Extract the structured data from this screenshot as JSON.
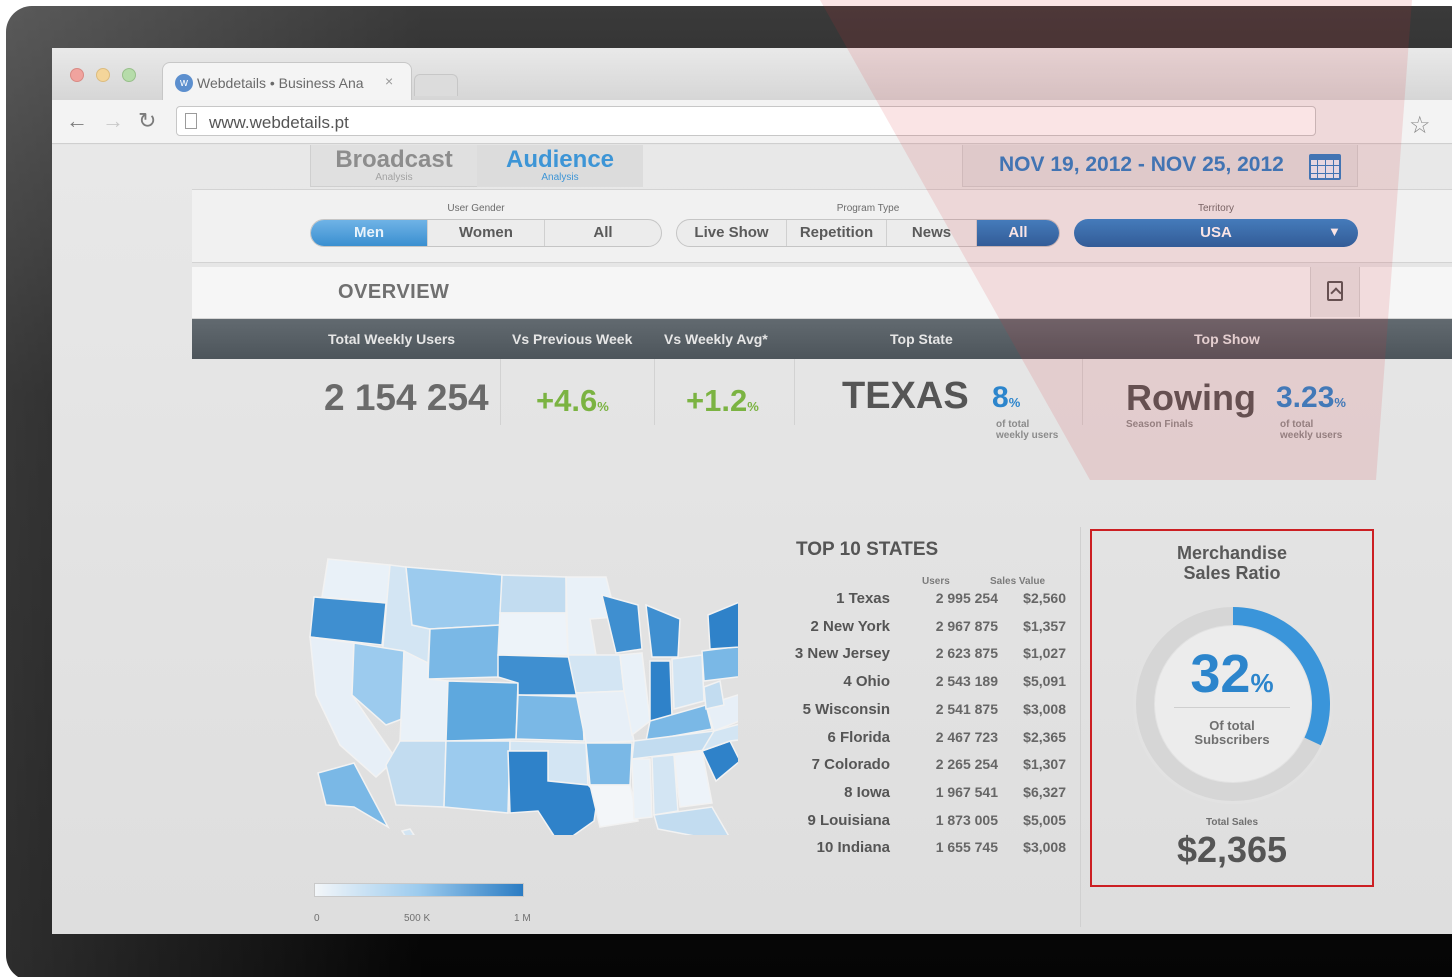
{
  "browser": {
    "tab_title": "Webdetails • Business Ana",
    "tab_close": "×",
    "favicon": "w",
    "url": "www.webdetails.pt",
    "icons": [
      "back-icon",
      "forward-icon",
      "reload-icon",
      "page-icon",
      "bookmark-star-icon"
    ]
  },
  "view_tabs": [
    {
      "title": "Broadcast",
      "sub": "Analysis"
    },
    {
      "title": "Audience",
      "sub": "Analysis"
    }
  ],
  "date_range": "NOV 19, 2012 - NOV 25, 2012",
  "filters": {
    "gender": {
      "label": "User Gender",
      "options": [
        "Men",
        "Women",
        "All"
      ],
      "selected": "Men"
    },
    "program": {
      "label": "Program Type",
      "options": [
        "Live Show",
        "Repetition",
        "News",
        "All"
      ],
      "selected": "All"
    },
    "territory": {
      "label": "Territory",
      "value": "USA",
      "arrow": "▼"
    }
  },
  "overview": {
    "title": "OVERVIEW"
  },
  "kpi_headers": [
    "Total Weekly Users",
    "Vs Previous Week",
    "Vs Weekly Avg*",
    "Top State",
    "Top Show"
  ],
  "kpis": {
    "total_users": "2 154 254",
    "vs_prev": "+4.6",
    "vs_avg": "+1.2",
    "pct_sign": "%",
    "top_state": "TEXAS",
    "top_state_pct": "8",
    "top_state_sub": [
      "of total",
      "weekly users"
    ],
    "top_show": "Rowing",
    "top_show_sub": "Season Finals",
    "top_show_pct": "3.23",
    "top_show_pct_sub": [
      "of total",
      "weekly users"
    ]
  },
  "map_legend": {
    "min": "0",
    "mid": "500 K",
    "max": "1 M"
  },
  "top_states": {
    "title": "TOP 10 STATES",
    "col_users": "Users",
    "col_sales": "Sales Value",
    "rows": [
      {
        "name": "1 Texas",
        "users": "2 995 254",
        "sales": "$2,560"
      },
      {
        "name": "2 New York",
        "users": "2 967 875",
        "sales": "$1,357"
      },
      {
        "name": "3 New Jersey",
        "users": "2 623 875",
        "sales": "$1,027"
      },
      {
        "name": "4 Ohio",
        "users": "2 543 189",
        "sales": "$5,091"
      },
      {
        "name": "5 Wisconsin",
        "users": "2 541 875",
        "sales": "$3,008"
      },
      {
        "name": "6 Florida",
        "users": "2 467 723",
        "sales": "$2,365"
      },
      {
        "name": "7 Colorado",
        "users": "2 265 254",
        "sales": "$1,307"
      },
      {
        "name": "8 Iowa",
        "users": "1 967 541",
        "sales": "$6,327"
      },
      {
        "name": "9 Louisiana",
        "users": "1 873 005",
        "sales": "$5,005"
      },
      {
        "name": "10 Indiana",
        "users": "1 655 745",
        "sales": "$3,008"
      }
    ]
  },
  "merchandise": {
    "title_line1": "Merchandise",
    "title_line2": "Sales Ratio",
    "ratio": 0.32,
    "ratio_text": "32",
    "ratio_sub1": "Of total",
    "ratio_sub2": "Subscribers",
    "total_label": "Total Sales",
    "total_value": "$2,365"
  },
  "colors": {
    "accent": "#2c85cc",
    "positive": "#7bb342",
    "highlight_border": "#cc1f23"
  }
}
